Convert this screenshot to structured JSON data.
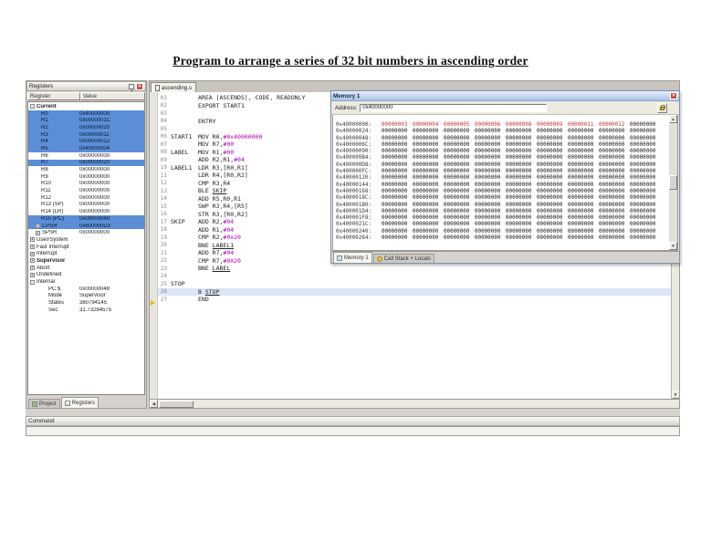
{
  "page_title": "Program to arrange a series of 32 bit numbers in ascending order",
  "colors": {
    "selection_blue": "#5b8ed6",
    "mem_red": "#c83232",
    "immediate_magenta": "#b000b0",
    "current_line_bg": "#dbe6f7",
    "arrow_yellow": "#e0c000",
    "close_red": "#c94f43"
  },
  "icons": {
    "registers_header": [
      "pin-icon",
      "close-icon"
    ],
    "memory_header": [
      "close-icon"
    ],
    "address_row": [
      "lock-icon"
    ],
    "current_line_marker": "arrow-right-icon"
  },
  "registers_panel": {
    "title": "Registers",
    "columns": [
      "Register",
      "Value"
    ],
    "current": {
      "label": "Current",
      "rows": [
        {
          "name": "R0",
          "value": "0x40000000",
          "sel": true
        },
        {
          "name": "R1",
          "value": "0x0000001C",
          "sel": true
        },
        {
          "name": "R2",
          "value": "0x00000020",
          "sel": true
        },
        {
          "name": "R3",
          "value": "0x00000011",
          "sel": true
        },
        {
          "name": "R4",
          "value": "0x00000012",
          "sel": true
        },
        {
          "name": "R5",
          "value": "0x40000004",
          "sel": true
        },
        {
          "name": "R6",
          "value": "0x00000000",
          "sel": false
        },
        {
          "name": "R7",
          "value": "0x00000020",
          "sel": true
        },
        {
          "name": "R8",
          "value": "0x00000000",
          "sel": false
        },
        {
          "name": "R9",
          "value": "0x00000000",
          "sel": false
        },
        {
          "name": "R10",
          "value": "0x00000000",
          "sel": false
        },
        {
          "name": "R11",
          "value": "0x00000000",
          "sel": false
        },
        {
          "name": "R12",
          "value": "0x00000000",
          "sel": false
        },
        {
          "name": "R13 (SP)",
          "value": "0x00000000",
          "sel": false
        },
        {
          "name": "R14 (LR)",
          "value": "0x00000000",
          "sel": false
        },
        {
          "name": "R15 (PC)",
          "value": "0x00000048",
          "sel": true
        },
        {
          "name": "CPSR",
          "value": "0x600000D3",
          "sel": true,
          "exp": true
        },
        {
          "name": "SPSR",
          "value": "0x00000000",
          "sel": false,
          "exp": true
        }
      ]
    },
    "groups": [
      {
        "label": "User/System"
      },
      {
        "label": "Fast Interrupt"
      },
      {
        "label": "Interrupt"
      },
      {
        "label": "Supervisor",
        "bold": true
      },
      {
        "label": "Abort"
      },
      {
        "label": "Undefined"
      }
    ],
    "internal": {
      "label": "Internal",
      "children": [
        [
          "PC $",
          "0x00000048"
        ],
        [
          "Mode",
          "Supervisor"
        ],
        [
          "States",
          "380794145"
        ],
        [
          "Sec",
          "31.73284575"
        ]
      ]
    },
    "tabs": [
      {
        "label": "Project",
        "icon": "project-icon"
      },
      {
        "label": "Registers",
        "icon": "registers-icon",
        "selected": true
      }
    ]
  },
  "editor": {
    "tab_label": "ascending.s",
    "lines": [
      {
        "n": "01",
        "l": "",
        "parts": [
          [
            "AREA |ASCENDS|, CODE, READONLY",
            "p"
          ]
        ]
      },
      {
        "n": "02",
        "l": "",
        "parts": [
          [
            "EXPORT START1",
            "p"
          ]
        ]
      },
      {
        "n": "03",
        "l": "",
        "parts": []
      },
      {
        "n": "04",
        "l": "",
        "parts": [
          [
            "ENTRY",
            "p"
          ]
        ]
      },
      {
        "n": "05",
        "l": "",
        "parts": []
      },
      {
        "n": "06",
        "l": "START1",
        "parts": [
          [
            "MOV R0,",
            "p"
          ],
          [
            "#0x40000000",
            "i"
          ]
        ]
      },
      {
        "n": "07",
        "l": "",
        "parts": [
          [
            "MOV R7,",
            "p"
          ],
          [
            "#00",
            "i"
          ]
        ]
      },
      {
        "n": "08",
        "l": "LABEL",
        "parts": [
          [
            "MOV R1,",
            "p"
          ],
          [
            "#00",
            "i"
          ]
        ]
      },
      {
        "n": "09",
        "l": "",
        "parts": [
          [
            "ADD R2,R1,",
            "p"
          ],
          [
            "#04",
            "i"
          ]
        ]
      },
      {
        "n": "10",
        "l": "LABEL1",
        "parts": [
          [
            "LDR R3,[R0,R1]",
            "p"
          ]
        ]
      },
      {
        "n": "11",
        "l": "",
        "parts": [
          [
            "LDR R4,[R0,R2]",
            "p"
          ]
        ]
      },
      {
        "n": "12",
        "l": "",
        "parts": [
          [
            "CMP R3,R4",
            "p"
          ]
        ]
      },
      {
        "n": "13",
        "l": "",
        "parts": [
          [
            "BLE ",
            "p"
          ],
          [
            "SKIP",
            "b"
          ]
        ]
      },
      {
        "n": "14",
        "l": "",
        "parts": [
          [
            "ADD R5,R0,R1",
            "p"
          ]
        ]
      },
      {
        "n": "15",
        "l": "",
        "parts": [
          [
            "SWP R3,R4,[R5]",
            "p"
          ]
        ]
      },
      {
        "n": "16",
        "l": "",
        "parts": [
          [
            "STR R3,[R0,R2]",
            "p"
          ]
        ]
      },
      {
        "n": "17",
        "l": "SKIP",
        "parts": [
          [
            "ADD R2,",
            "p"
          ],
          [
            "#04",
            "i"
          ]
        ]
      },
      {
        "n": "18",
        "l": "",
        "parts": [
          [
            "ADD R1,",
            "p"
          ],
          [
            "#04",
            "i"
          ]
        ]
      },
      {
        "n": "19",
        "l": "",
        "parts": [
          [
            "CMP R2,",
            "p"
          ],
          [
            "#0x20",
            "i"
          ]
        ]
      },
      {
        "n": "20",
        "l": "",
        "parts": [
          [
            "BNE ",
            "p"
          ],
          [
            "LABEL1",
            "b"
          ]
        ]
      },
      {
        "n": "21",
        "l": "",
        "parts": [
          [
            "ADD R7,",
            "p"
          ],
          [
            "#04",
            "i"
          ]
        ]
      },
      {
        "n": "22",
        "l": "",
        "parts": [
          [
            "CMP R7,",
            "p"
          ],
          [
            "#0X20",
            "i"
          ]
        ]
      },
      {
        "n": "23",
        "l": "",
        "parts": [
          [
            "BNE ",
            "p"
          ],
          [
            "LABEL",
            "b"
          ]
        ]
      },
      {
        "n": "24",
        "l": "",
        "parts": []
      },
      {
        "n": "25",
        "l": "STOP",
        "parts": []
      },
      {
        "n": "26",
        "l": "",
        "parts": [
          [
            "B ",
            "p"
          ],
          [
            "STOP",
            "b"
          ]
        ],
        "current": true
      },
      {
        "n": "27",
        "l": "",
        "parts": [
          [
            "END",
            "p"
          ]
        ]
      }
    ]
  },
  "memory_window": {
    "title": "Memory 1",
    "address_label": "Address:",
    "address_value": "0x40000000",
    "rows": [
      {
        "addr": "0x40000000:",
        "vals": [
          "00000003",
          "00000004",
          "00000005",
          "00000006",
          "00000008",
          "00000009",
          "00000011",
          "00000012",
          "00000000"
        ],
        "red": 8
      },
      {
        "addr": "0x40000024:",
        "fill": "00000000",
        "count": 9,
        "red": 0
      },
      {
        "addr": "0x40000048:",
        "fill": "00000000",
        "count": 9,
        "red": 0
      },
      {
        "addr": "0x4000006C:",
        "fill": "00000000",
        "count": 9,
        "red": 0
      },
      {
        "addr": "0x40000090:",
        "fill": "00000000",
        "count": 9,
        "red": 0
      },
      {
        "addr": "0x400000B4:",
        "fill": "00000000",
        "count": 9,
        "red": 0
      },
      {
        "addr": "0x400000D8:",
        "fill": "00000000",
        "count": 9,
        "red": 0
      },
      {
        "addr": "0x400000FC:",
        "fill": "00000000",
        "count": 9,
        "red": 0
      },
      {
        "addr": "0x40000120:",
        "fill": "00000000",
        "count": 9,
        "red": 0
      },
      {
        "addr": "0x40000144:",
        "fill": "00000000",
        "count": 9,
        "red": 0
      },
      {
        "addr": "0x40000168:",
        "fill": "00000000",
        "count": 9,
        "red": 0
      },
      {
        "addr": "0x4000018C:",
        "fill": "00000000",
        "count": 9,
        "red": 0
      },
      {
        "addr": "0x400001B0:",
        "fill": "00000000",
        "count": 9,
        "red": 0
      },
      {
        "addr": "0x400001D4:",
        "fill": "00000000",
        "count": 9,
        "red": 0
      },
      {
        "addr": "0x400001F8:",
        "fill": "00000000",
        "count": 9,
        "red": 0
      },
      {
        "addr": "0x4000021C:",
        "fill": "00000000",
        "count": 9,
        "red": 0
      },
      {
        "addr": "0x40000240:",
        "fill": "00000000",
        "count": 9,
        "red": 0
      },
      {
        "addr": "0x40000264:",
        "fill": "00000000",
        "count": 9,
        "red": 0
      }
    ],
    "tabs": [
      {
        "label": "Memory 1",
        "icon": "memory-icon",
        "selected": true
      },
      {
        "label": "Call Stack + Locals",
        "icon": "callstack-icon"
      }
    ]
  },
  "command_bar": {
    "label": "Command"
  }
}
